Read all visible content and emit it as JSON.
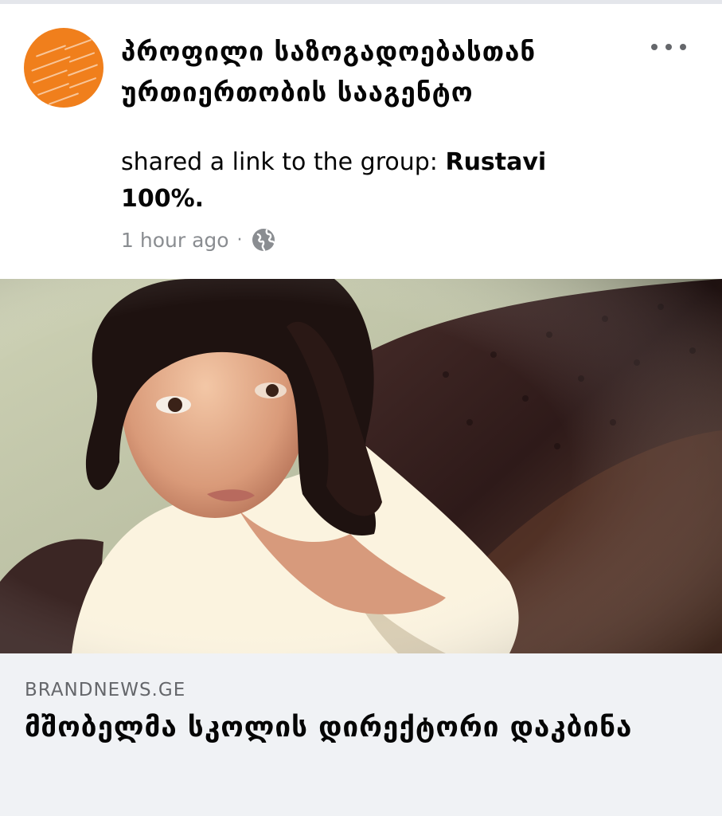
{
  "post": {
    "author": "პროფილი საზოგადოებასთან ურთიერთობის სააგენტო",
    "shared_text": "shared a link to the group:",
    "group_name": "Rustavi 100%.",
    "timestamp": "1 hour ago",
    "separator": "·",
    "privacy_icon": "globe-icon",
    "menu_icon": "more-horizontal-icon"
  },
  "link": {
    "domain": "BRANDNEWS.GE",
    "title": "მშობელმა სკოლის დირექტორი დაკბინა"
  },
  "colors": {
    "avatar_bg": "#f07f1c",
    "link_box_bg": "#f0f2f5",
    "meta_text": "#8a8d91",
    "text": "#050505"
  }
}
